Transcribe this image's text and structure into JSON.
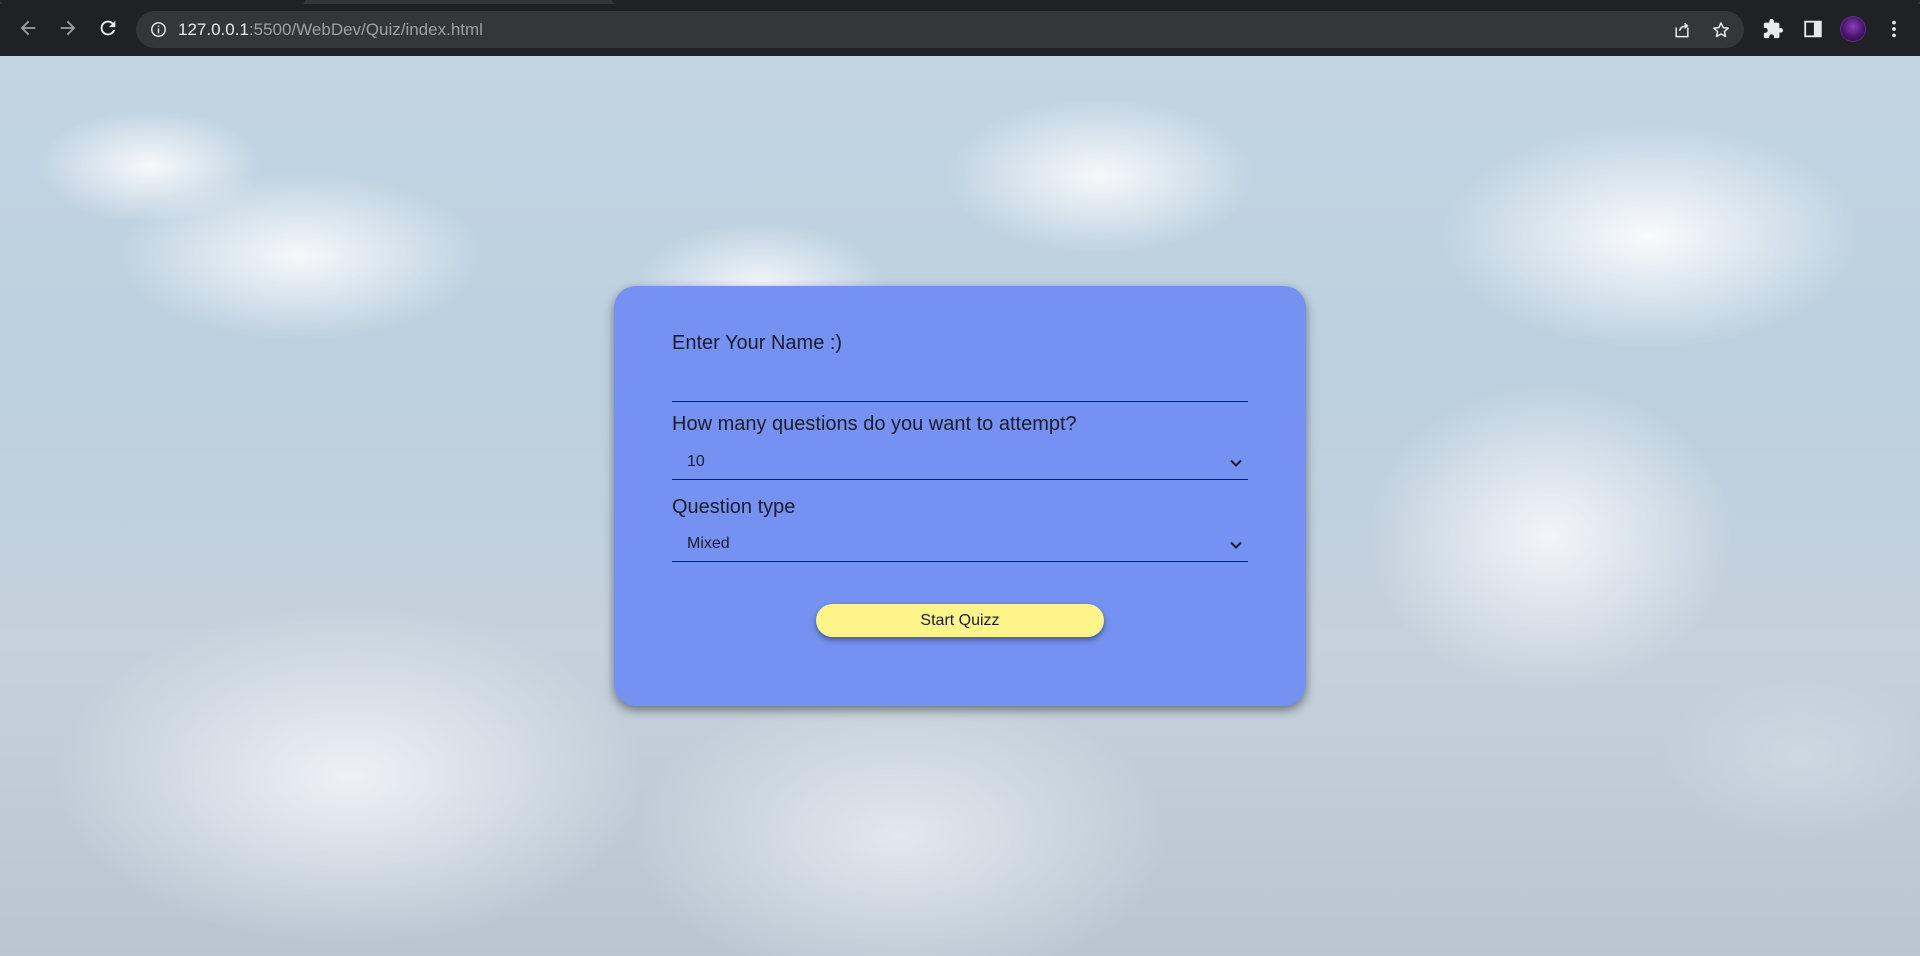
{
  "browser": {
    "url_host": "127.0.0.1",
    "url_rest": ":5500/WebDev/Quiz/index.html"
  },
  "quiz_form": {
    "name_label": "Enter Your Name :)",
    "name_value": "",
    "count_label": "How many questions do you want to attempt?",
    "count_selected": "10",
    "type_label": "Question type",
    "type_selected": "Mixed",
    "start_button": "Start Quizz"
  },
  "colors": {
    "card": "#7592f2",
    "button": "#fdf58a",
    "browser_bar": "#202124"
  }
}
